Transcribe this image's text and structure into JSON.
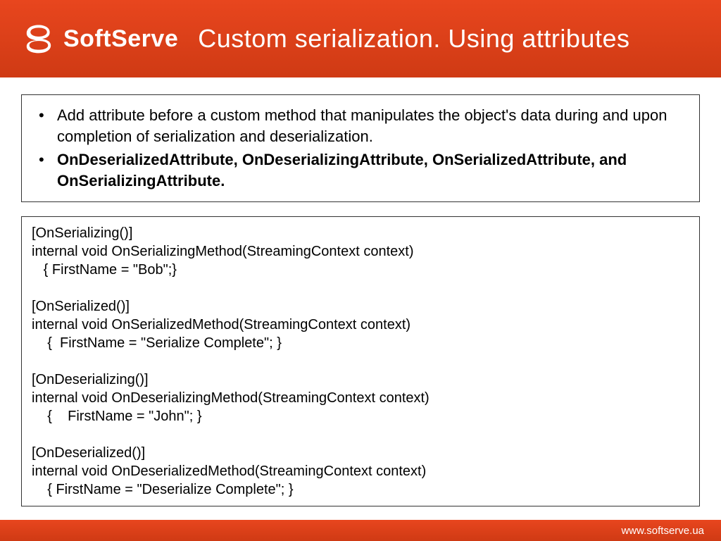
{
  "header": {
    "brand": "SoftServe",
    "title": "Custom serialization. Using attributes"
  },
  "bullets": [
    {
      "text": "Add attribute before a custom method that manipulates the object's data during and upon completion of serialization and deserialization.",
      "bold": false
    },
    {
      "text": "OnDeserializedAttribute, OnDeserializingAttribute, OnSerializedAttribute, and OnSerializingAttribute.",
      "bold": true
    }
  ],
  "code": "[OnSerializing()]\ninternal void OnSerializingMethod(StreamingContext context)\n   { FirstName = \"Bob\";}\n\n[OnSerialized()]\ninternal void OnSerializedMethod(StreamingContext context)\n    {  FirstName = \"Serialize Complete\"; }\n\n[OnDeserializing()]\ninternal void OnDeserializingMethod(StreamingContext context)\n    {    FirstName = \"John\"; }\n\n[OnDeserialized()]\ninternal void OnDeserializedMethod(StreamingContext context)\n    { FirstName = \"Deserialize Complete\"; }",
  "footer": {
    "url": "www.softserve.ua"
  }
}
